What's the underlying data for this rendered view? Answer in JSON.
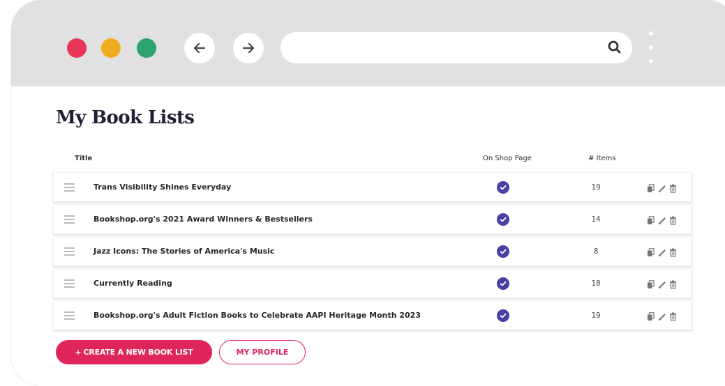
{
  "page": {
    "title": "My Book Lists"
  },
  "table": {
    "headers": {
      "title": "Title",
      "on_shop": "On Shop Page",
      "items": "# Items"
    },
    "rows": [
      {
        "title": "Trans Visibility Shines Everyday",
        "on_shop": true,
        "count": "19"
      },
      {
        "title": "Bookshop.org's 2021 Award Winners & Bestsellers",
        "on_shop": true,
        "count": "14"
      },
      {
        "title": "Jazz Icons: The Stories of America's Music",
        "on_shop": true,
        "count": "8"
      },
      {
        "title": "Currently Reading",
        "on_shop": true,
        "count": "10"
      },
      {
        "title": "Bookshop.org's Adult Fiction Books to Celebrate AAPI Heritage Month 2023",
        "on_shop": true,
        "count": "19"
      }
    ]
  },
  "buttons": {
    "create_plus": "+",
    "create_label": "CREATE A NEW BOOK LIST",
    "profile_label": "MY PROFILE"
  },
  "browser": {
    "address_value": "",
    "traffic_lights": {
      "close": "#e8375a",
      "minimize": "#f2ac1f",
      "maximize": "#2aa370"
    }
  },
  "colors": {
    "accent": "#e0255a",
    "check": "#4b3fa6",
    "chrome": "#e1e1e1"
  },
  "icons": [
    "back-arrow-icon",
    "forward-arrow-icon",
    "search-icon",
    "kebab-menu-icon",
    "drag-handle-icon",
    "checkmark-icon",
    "copy-icon",
    "pencil-icon",
    "trash-icon"
  ]
}
